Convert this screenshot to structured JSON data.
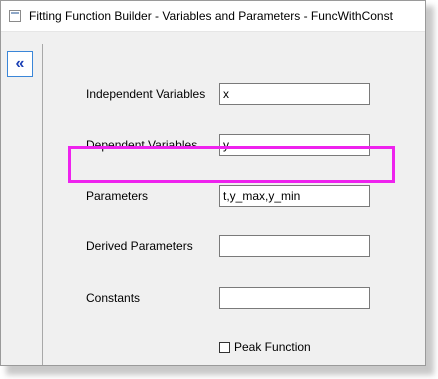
{
  "window": {
    "title": "Fitting Function Builder - Variables and Parameters - FuncWithConst"
  },
  "collapse_button": {
    "label": "«"
  },
  "form": {
    "independent_variables": {
      "label": "Independent Variables",
      "value": "x"
    },
    "dependent_variables": {
      "label": "Dependent Variables",
      "value": "y"
    },
    "parameters": {
      "label": "Parameters",
      "value": "t,y_max,y_min"
    },
    "derived_parameters": {
      "label": "Derived Parameters",
      "value": ""
    },
    "constants": {
      "label": "Constants",
      "value": ""
    },
    "peak_function": {
      "label": "Peak Function",
      "checked": false
    }
  },
  "colors": {
    "highlight": "#ee22ee",
    "collapse_border": "#3a86d8",
    "collapse_arrow": "#1a3fb5"
  }
}
